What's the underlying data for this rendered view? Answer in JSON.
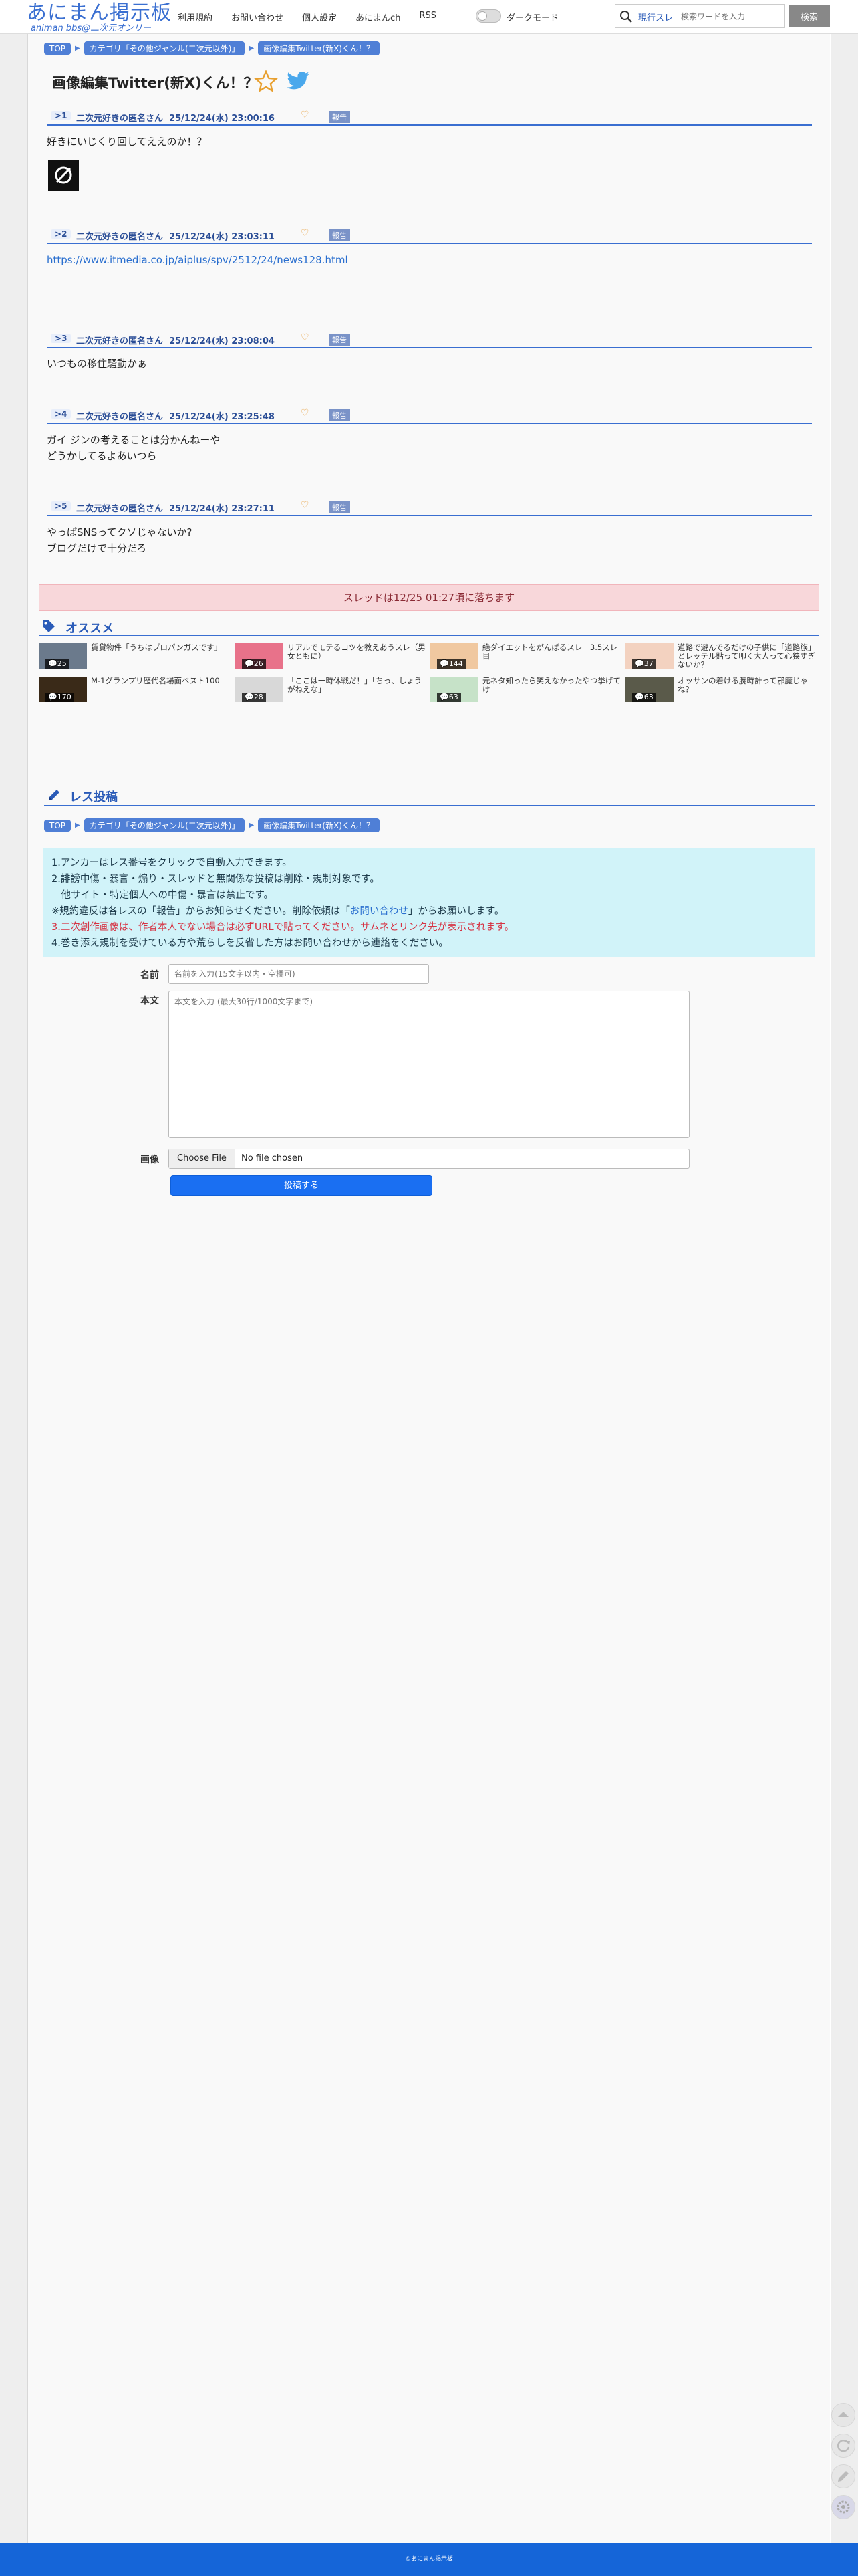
{
  "header": {
    "logo_main": "あにまん掲示板",
    "logo_sub": "animan bbs@二次元オンリー",
    "nav": [
      "利用規約",
      "お問い合わせ",
      "個人設定",
      "あにまんch",
      "RSS"
    ],
    "dark_mode_label": "ダークモード",
    "search_scope": "現行スレ",
    "search_placeholder": "検索ワードを入力",
    "search_button": "検索"
  },
  "breadcrumb": [
    "TOP",
    "カテゴリ「その他ジャンル(二次元以外)」",
    "画像編集Twitter(新X)くん！？"
  ],
  "thread": {
    "title": "画像編集Twitter(新X)くん！？"
  },
  "posts": [
    {
      "num": "1",
      "name": "二次元好きの匿名さん",
      "date": "25/12/24(水) 23:00:16",
      "report": "報告",
      "lines": [
        "好きにいじくり回してええのか！？"
      ]
    },
    {
      "num": "2",
      "name": "二次元好きの匿名さん",
      "date": "25/12/24(水) 23:03:11",
      "report": "報告",
      "lines": [
        "https://www.itmedia.co.jp/aiplus/spv/2512/24/news128.html"
      ]
    },
    {
      "num": "3",
      "name": "二次元好きの匿名さん",
      "date": "25/12/24(水) 23:08:04",
      "report": "報告",
      "lines": [
        "いつもの移住騒動かぁ"
      ]
    },
    {
      "num": "4",
      "name": "二次元好きの匿名さん",
      "date": "25/12/24(水) 23:25:48",
      "report": "報告",
      "lines": [
        "ガイ ジンの考えることは分かんねーや",
        "どうかしてるよあいつら"
      ]
    },
    {
      "num": "5",
      "name": "二次元好きの匿名さん",
      "date": "25/12/24(水) 23:27:11",
      "report": "報告",
      "lines": [
        "やっぱSNSってクソじゃないか?",
        "ブログだけで十分だろ"
      ]
    }
  ],
  "expire_notice": "スレッドは12/25 01:27頃に落ちます",
  "recommend": {
    "title": "オススメ",
    "items": [
      {
        "count": "25",
        "text": "賃貸物件「うちはプロパンガスです」",
        "color": "#6b7a8c"
      },
      {
        "count": "26",
        "text": "リアルでモテるコツを教えあうスレ（男女ともに）",
        "color": "#e8728a"
      },
      {
        "count": "144",
        "text": "絶ダイエットをがんばるスレ　3.5スレ目",
        "color": "#f0c8a0"
      },
      {
        "count": "37",
        "text": "道路で遊んでるだけの子供に「道路族」とレッテル貼って叩く大人って心狭すぎないか？",
        "color": "#f3d2c0"
      },
      {
        "count": "170",
        "text": "M-1グランプリ歴代名場面ベスト100",
        "color": "#3a2a18"
      },
      {
        "count": "28",
        "text": "「ここは一時休戦だ！」「ちっ、しょうがねえな」",
        "color": "#d8d8d8"
      },
      {
        "count": "63",
        "text": "元ネタ知ったら笑えなかったやつ挙げてけ",
        "color": "#c6e2c8"
      },
      {
        "count": "63",
        "text": "オッサンの着ける腕時計って邪魔じゃね？",
        "color": "#5a5a4a"
      }
    ]
  },
  "reply_form": {
    "title": "レス投稿",
    "notice": [
      "1.アンカーはレス番号をクリックで自動入力できます。",
      "2.誹謗中傷・暴言・煽り・スレッドと無関係な投稿は削除・規制対象です。",
      "　他サイト・特定個人への中傷・暴言は禁止です。",
      "※規約違反は各レスの「報告」からお知らせください。削除依頼は「お問い合わせ」からお願いします。",
      "3.二次創作画像は、作者本人でない場合は必ずURLで貼ってください。サムネとリンク先が表示されます。",
      "4.巻き添え規制を受けている方や荒らしを反省した方はお問い合わせから連絡をください。"
    ],
    "notice_link": "お問い合わせ",
    "name_label": "名前",
    "name_placeholder": "名前を入力(15文字以内・空欄可)",
    "body_label": "本文",
    "body_placeholder": "本文を入力 (最大30行/1000文字まで)",
    "image_label": "画像",
    "file_button": "Choose File",
    "file_status": "No file chosen",
    "submit": "投稿する"
  },
  "footer": {
    "copyright": "©あにまん掲示板"
  },
  "colors": {
    "accent": "#3a6fd1",
    "footer": "#1565d8",
    "submit": "#1a6ff2"
  }
}
